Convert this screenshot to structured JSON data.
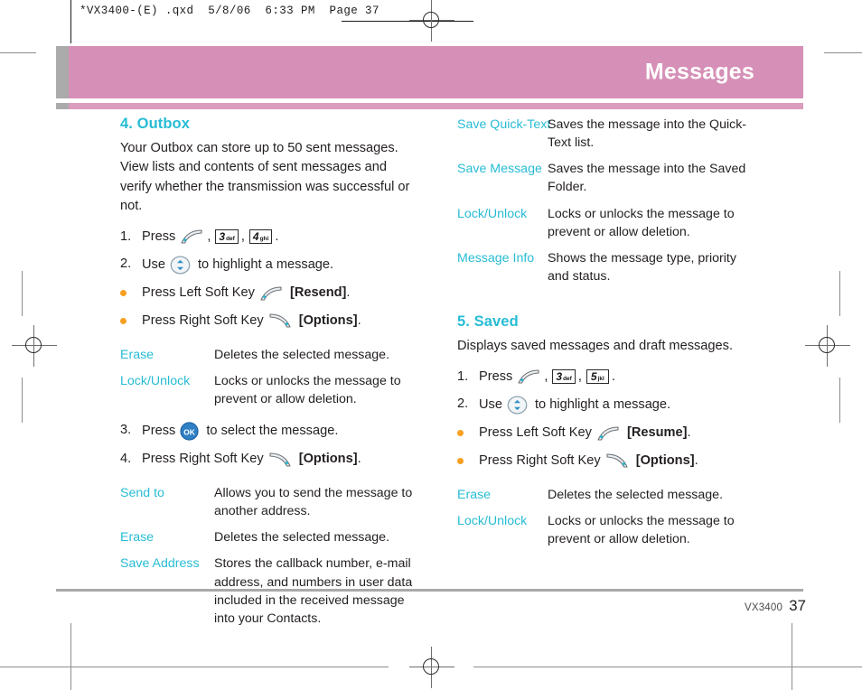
{
  "prepress": {
    "slug": "*VX3400-(E) .qxd  5/8/06  6:33 PM  Page 37"
  },
  "banner": {
    "title": "Messages",
    "bg_color": "#d68fb6",
    "accent_color": "#ababab",
    "title_color": "#ffffff"
  },
  "theme": {
    "term_color": "#27bcd4",
    "heading_color": "#27bcd4",
    "bullet_color": "#f6a020",
    "body_color": "#231f20"
  },
  "left_column": {
    "heading": "4. Outbox",
    "intro": "Your Outbox can store up to 50 sent messages. View lists and contents of sent messages and verify whether the transmission was successful or not.",
    "steps_1": [
      {
        "num": "1.",
        "parts": [
          {
            "type": "text",
            "value": "Press"
          },
          {
            "type": "icon",
            "name": "send-key-icon"
          },
          {
            "type": "text",
            "value": ","
          },
          {
            "type": "key",
            "digit": "3",
            "letters": "def"
          },
          {
            "type": "text",
            "value": ","
          },
          {
            "type": "key",
            "digit": "4",
            "letters": "ghi"
          },
          {
            "type": "text",
            "value": "."
          }
        ]
      },
      {
        "num": "2.",
        "parts": [
          {
            "type": "text",
            "value": "Use"
          },
          {
            "type": "icon",
            "name": "navigation-key-icon"
          },
          {
            "type": "text",
            "value": "to highlight a message."
          }
        ]
      }
    ],
    "bullets_1": [
      {
        "parts": [
          {
            "type": "text",
            "value": "Press Left Soft Key"
          },
          {
            "type": "icon",
            "name": "left-soft-key-icon"
          },
          {
            "type": "bold",
            "value": "[Resend]"
          },
          {
            "type": "text",
            "value": "."
          }
        ]
      },
      {
        "parts": [
          {
            "type": "text",
            "value": "Press Right Soft Key"
          },
          {
            "type": "icon",
            "name": "right-soft-key-icon"
          },
          {
            "type": "bold",
            "value": "[Options]"
          },
          {
            "type": "text",
            "value": "."
          }
        ]
      }
    ],
    "definitions_1": [
      {
        "term": "Erase",
        "desc": "Deletes the selected message."
      },
      {
        "term": "Lock/Unlock",
        "desc": "Locks or unlocks the message to prevent or allow deletion."
      }
    ],
    "steps_2": [
      {
        "num": "3.",
        "parts": [
          {
            "type": "text",
            "value": "Press"
          },
          {
            "type": "icon",
            "name": "ok-key-icon"
          },
          {
            "type": "text",
            "value": "to select the message."
          }
        ]
      },
      {
        "num": "4.",
        "parts": [
          {
            "type": "text",
            "value": "Press Right Soft Key"
          },
          {
            "type": "icon",
            "name": "right-soft-key-icon"
          },
          {
            "type": "bold",
            "value": "[Options]"
          },
          {
            "type": "text",
            "value": "."
          }
        ]
      }
    ],
    "definitions_2": [
      {
        "term": "Send to",
        "desc": "Allows you to send the message to another address."
      },
      {
        "term": "Erase",
        "desc": "Deletes the selected message."
      },
      {
        "term": "Save Address",
        "desc": "Stores the callback number, e-mail address, and numbers in user data included in the received message into your Contacts."
      }
    ]
  },
  "right_column": {
    "definitions_continued": [
      {
        "term": "Save Quick-Text",
        "desc": "Saves the message into the Quick-Text list."
      },
      {
        "term": "Save Message",
        "desc": "Saves the message into the Saved Folder."
      },
      {
        "term": "Lock/Unlock",
        "desc": "Locks or unlocks the message to prevent or allow deletion."
      },
      {
        "term": "Message Info",
        "desc": "Shows the message type, priority and status."
      }
    ],
    "heading": "5. Saved",
    "intro": "Displays saved messages and draft messages.",
    "steps": [
      {
        "num": "1.",
        "parts": [
          {
            "type": "text",
            "value": "Press"
          },
          {
            "type": "icon",
            "name": "send-key-icon"
          },
          {
            "type": "text",
            "value": ","
          },
          {
            "type": "key",
            "digit": "3",
            "letters": "def"
          },
          {
            "type": "text",
            "value": ","
          },
          {
            "type": "key",
            "digit": "5",
            "letters": "jkl"
          },
          {
            "type": "text",
            "value": "."
          }
        ]
      },
      {
        "num": "2.",
        "parts": [
          {
            "type": "text",
            "value": "Use"
          },
          {
            "type": "icon",
            "name": "navigation-key-icon"
          },
          {
            "type": "text",
            "value": "to highlight a message."
          }
        ]
      }
    ],
    "bullets": [
      {
        "parts": [
          {
            "type": "text",
            "value": "Press Left Soft Key"
          },
          {
            "type": "icon",
            "name": "left-soft-key-icon"
          },
          {
            "type": "bold",
            "value": "[Resume]"
          },
          {
            "type": "text",
            "value": "."
          }
        ]
      },
      {
        "parts": [
          {
            "type": "text",
            "value": "Press Right Soft Key"
          },
          {
            "type": "icon",
            "name": "right-soft-key-icon"
          },
          {
            "type": "bold",
            "value": "[Options]"
          },
          {
            "type": "text",
            "value": "."
          }
        ]
      }
    ],
    "definitions": [
      {
        "term": "Erase",
        "desc": "Deletes the selected message."
      },
      {
        "term": "Lock/Unlock",
        "desc": "Locks or unlocks the message to prevent or allow deletion."
      }
    ]
  },
  "footer": {
    "model": "VX3400",
    "page_number": "37"
  }
}
